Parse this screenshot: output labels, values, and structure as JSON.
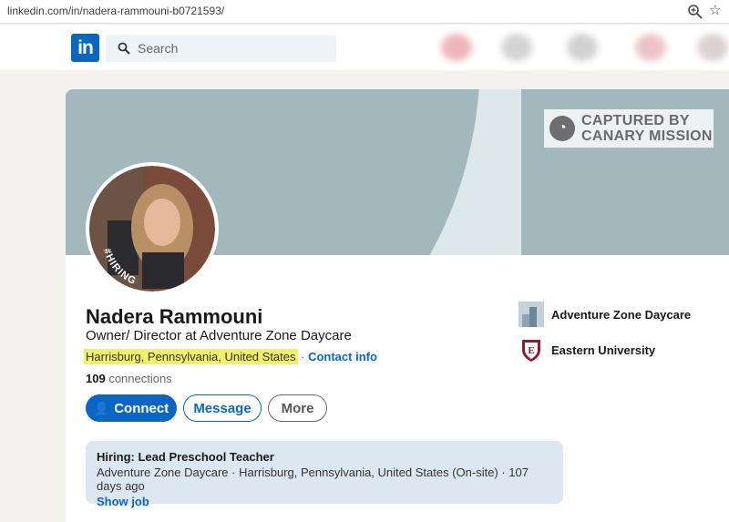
{
  "browser": {
    "url": "linkedin.com/in/nadera-rammouni-b0721593/"
  },
  "nav": {
    "logo_text": "in",
    "search_placeholder": "Search"
  },
  "watermark": {
    "line1": "CAPTURED BY",
    "line2": "CANARY MISSION"
  },
  "profile": {
    "avatar_badge": "#HIRING",
    "name": "Nadera Rammouni",
    "headline": "Owner/ Director at Adventure Zone Daycare",
    "location": "Harrisburg, Pennsylvania, United States",
    "separator": " · ",
    "contact_info": "Contact info",
    "connections_count": "109",
    "connections_label": " connections"
  },
  "actions": {
    "connect": "Connect",
    "message": "Message",
    "more": "More"
  },
  "experience": {
    "company": "Adventure Zone Daycare",
    "school": "Eastern University"
  },
  "hiring": {
    "title": "Hiring: Lead Preschool Teacher",
    "subtitle": "Adventure Zone Daycare · Harrisburg, Pennsylvania, United States (On-site) · 107 days ago",
    "link": "Show job"
  },
  "colors": {
    "brand": "#0a66c2",
    "highlight": "#f0f06a",
    "hiring_frame": "#7a3fc9"
  }
}
